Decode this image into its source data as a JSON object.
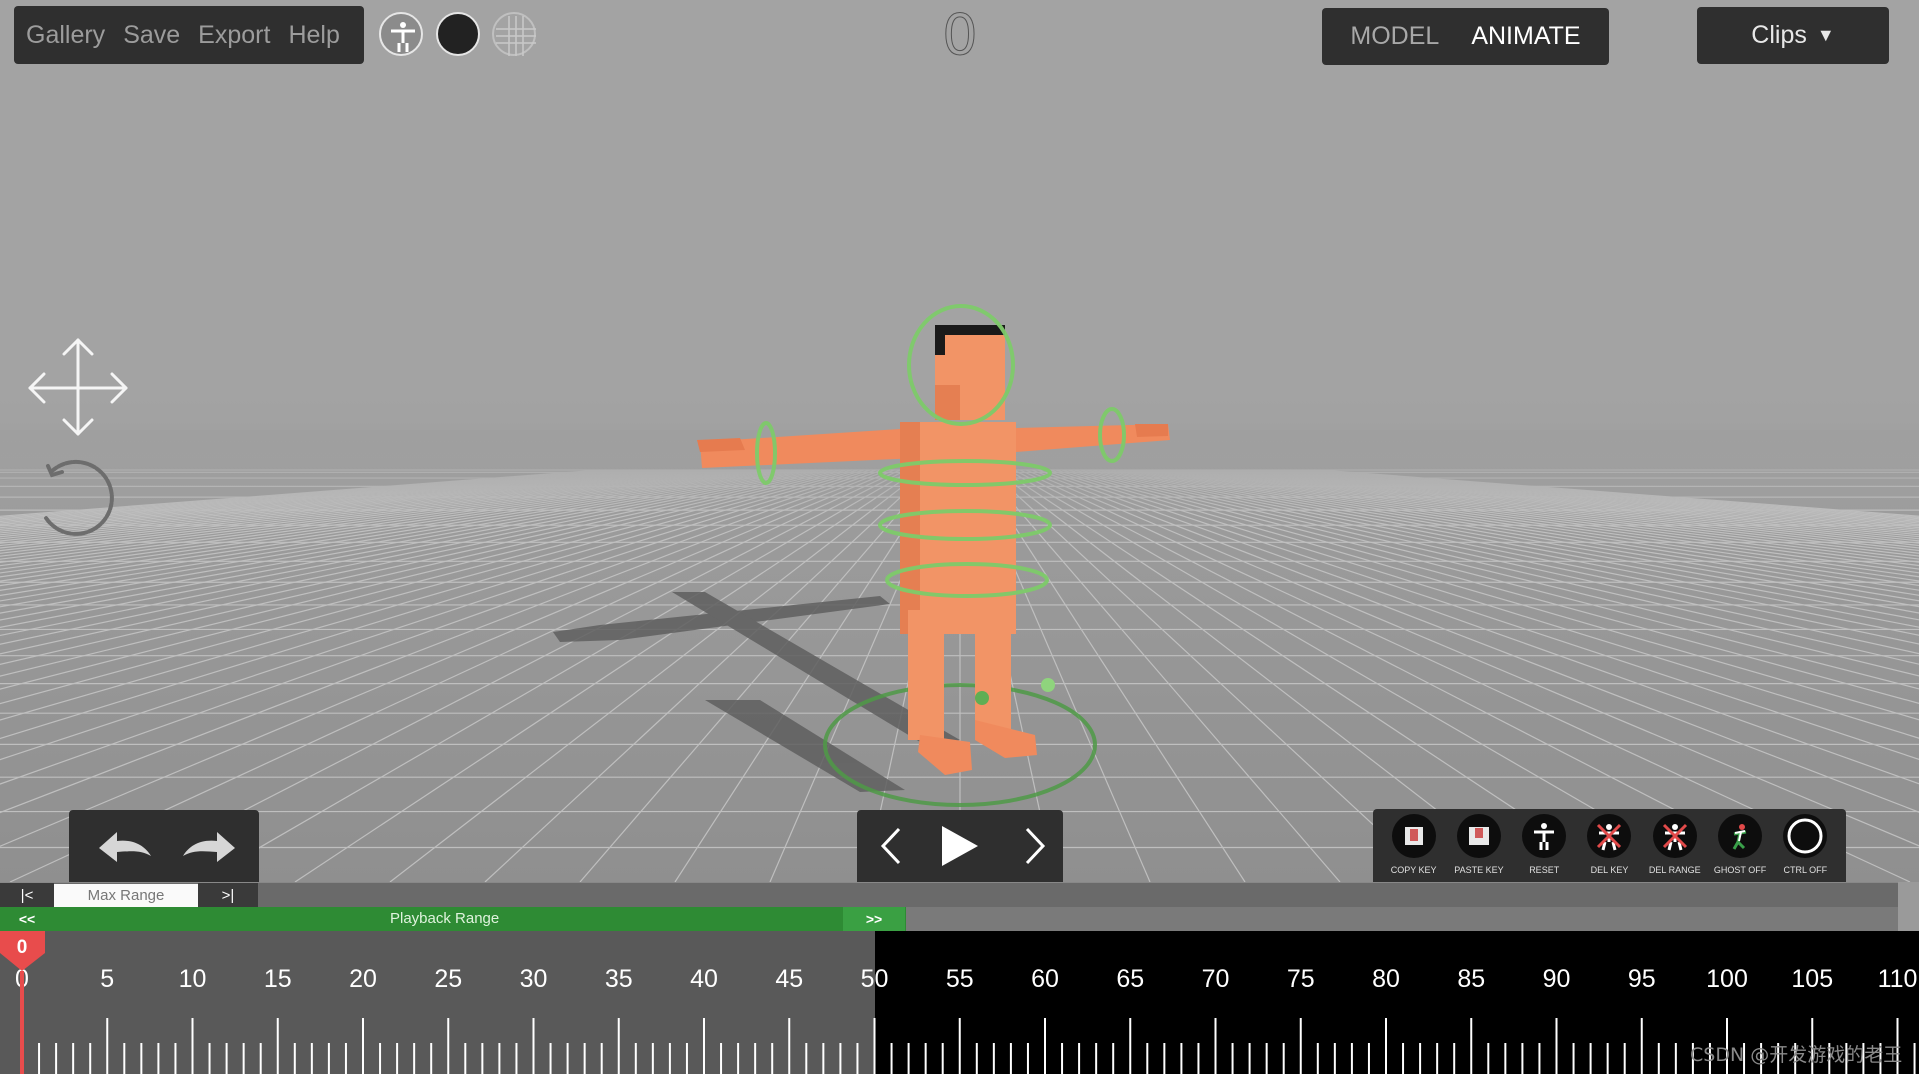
{
  "menu": {
    "items": [
      "Gallery",
      "Save",
      "Export",
      "Help"
    ]
  },
  "view_toggles": [
    "skeleton-view-icon",
    "solid-view-icon",
    "wireframe-view-icon"
  ],
  "frame_counter": "0",
  "mode": {
    "model_label": "MODEL",
    "animate_label": "ANIMATE",
    "active": "ANIMATE"
  },
  "clips": {
    "label": "Clips"
  },
  "left_tools": [
    "move-icon",
    "rotate-icon"
  ],
  "history": [
    "undo-icon",
    "redo-icon"
  ],
  "playback_controls": [
    "prev-frame-icon",
    "play-icon",
    "next-frame-icon"
  ],
  "key_tools": [
    {
      "label": "COPY KEY",
      "icon": "copy-key-icon"
    },
    {
      "label": "PASTE KEY",
      "icon": "paste-key-icon"
    },
    {
      "label": "RESET",
      "icon": "reset-pose-icon"
    },
    {
      "label": "DEL KEY",
      "icon": "delete-key-icon"
    },
    {
      "label": "DEL RANGE",
      "icon": "delete-range-icon"
    },
    {
      "label": "GHOST OFF",
      "icon": "ghost-icon"
    },
    {
      "label": "CTRL OFF",
      "icon": "ctrl-ring-icon"
    }
  ],
  "timeline": {
    "jump_start_label": "|<",
    "max_range_label": "Max Range",
    "jump_end_label": ">|",
    "playback_start_label": "<<",
    "playback_label": "Playback Range",
    "playback_end_label": ">>",
    "current_frame": "0",
    "playback_range_end_frame": 50,
    "tick_labels": [
      "0",
      "5",
      "10",
      "15",
      "20",
      "25",
      "30",
      "35",
      "40",
      "45",
      "50",
      "55",
      "60",
      "65",
      "70",
      "75",
      "80",
      "85",
      "90",
      "95",
      "100",
      "105",
      "110"
    ]
  },
  "watermark": "CSDN @开发游戏的老王",
  "colors": {
    "panel": "#2f2f2f",
    "skin": "#f08a5d",
    "control_ring": "#7ecb6a",
    "playback_green": "#2e8b34",
    "playhead": "#e84c4c"
  }
}
